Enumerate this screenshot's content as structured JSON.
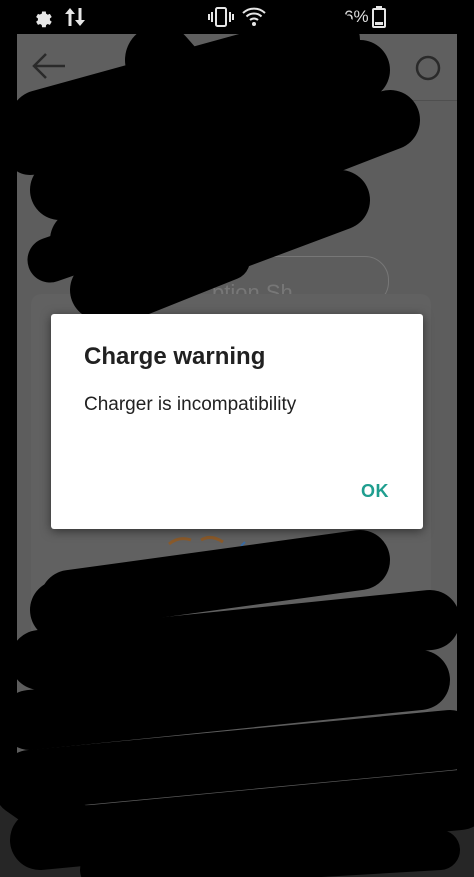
{
  "status_bar": {
    "battery_text": "6%",
    "icons": [
      "settings-icon",
      "data-transfer-icon",
      "vibrate-icon",
      "wifi-icon",
      "battery-icon"
    ]
  },
  "app": {
    "partial_button_text": "ption Sh"
  },
  "dialog": {
    "title": "Charge warning",
    "message": "Charger is incompatibility",
    "ok_label": "OK"
  },
  "colors": {
    "accent": "#1f9e8f",
    "dialog_bg": "#ffffff",
    "scrim": "#5d5d5d"
  }
}
